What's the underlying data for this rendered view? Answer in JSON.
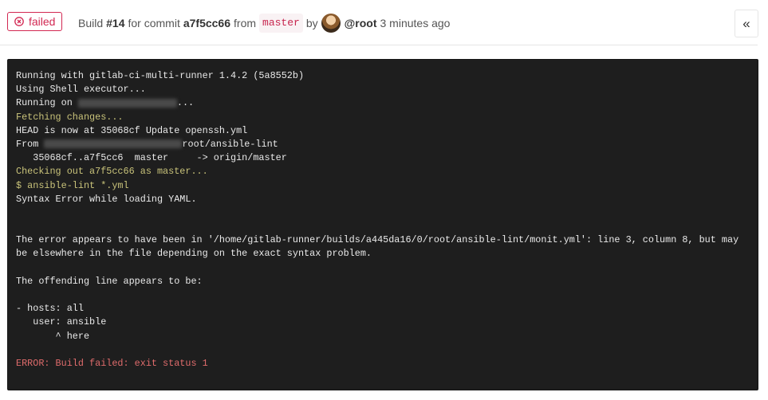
{
  "header": {
    "status": "failed",
    "build_word": "Build",
    "build_number": "#14",
    "for_commit": "for commit",
    "commit_sha": "a7f5cc66",
    "from_word": "from",
    "branch": "master",
    "by_word": "by",
    "user": "@root",
    "time": "3 minutes ago",
    "toggle_label": "«"
  },
  "terminal": {
    "lines": [
      {
        "text": "Running with gitlab-ci-multi-runner 1.4.2 (5a8552b)",
        "style": "normal"
      },
      {
        "text": "Using Shell executor...",
        "style": "normal"
      },
      {
        "text_prefix": "Running on ",
        "text_suffix": "...",
        "style": "normal"
      },
      {
        "text": "Fetching changes...",
        "style": "yellow"
      },
      {
        "text": "HEAD is now at 35068cf Update openssh.yml",
        "style": "normal"
      },
      {
        "text_prefix": "From ",
        "text_suffix": "root/ansible-lint",
        "style": "normal"
      },
      {
        "text": "   35068cf..a7f5cc6  master     -> origin/master",
        "style": "normal"
      },
      {
        "text": "Checking out a7f5cc66 as master...",
        "style": "yellow"
      },
      {
        "text": "$ ansible-lint *.yml",
        "style": "yellow"
      },
      {
        "text": "Syntax Error while loading YAML.",
        "style": "normal"
      },
      {
        "text": "",
        "style": "normal"
      },
      {
        "text": "",
        "style": "normal"
      },
      {
        "text": "The error appears to have been in '/home/gitlab-runner/builds/a445da16/0/root/ansible-lint/monit.yml': line 3, column 8, but may be elsewhere in the file depending on the exact syntax problem.",
        "style": "normal"
      },
      {
        "text": "",
        "style": "normal"
      },
      {
        "text": "The offending line appears to be:",
        "style": "normal"
      },
      {
        "text": "",
        "style": "normal"
      },
      {
        "text": "- hosts: all",
        "style": "normal"
      },
      {
        "text": "   user: ansible",
        "style": "normal"
      },
      {
        "text": "       ^ here",
        "style": "normal"
      },
      {
        "text": "",
        "style": "normal"
      },
      {
        "text": "ERROR: Build failed: exit status 1",
        "style": "red"
      }
    ]
  },
  "colors": {
    "failed": "#d22852",
    "terminal_bg": "#1e1e1e",
    "terminal_yellow": "#c9c37a",
    "terminal_red": "#e06c6c"
  }
}
